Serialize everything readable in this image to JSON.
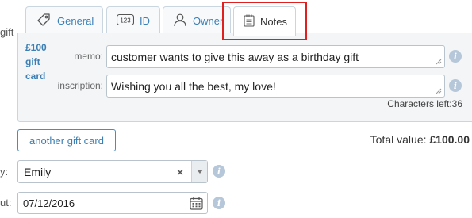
{
  "left_cut_labels": {
    "gift": "gift",
    "by": "y:",
    "out": "ut:"
  },
  "tabs": [
    {
      "label": "General",
      "icon": "tag-icon"
    },
    {
      "label": "ID",
      "icon": "id-123-icon",
      "icon_text": "123"
    },
    {
      "label": "Owner",
      "icon": "user-icon"
    },
    {
      "label": "Notes",
      "icon": "notepad-icon",
      "active": true
    }
  ],
  "card": {
    "line1": "£100",
    "line2": "gift",
    "line3": "card"
  },
  "memo": {
    "label": "memo:",
    "value": "customer wants to give this away as a birthday gift"
  },
  "inscription": {
    "label": "inscription:",
    "value": "Wishing you all the best, my love!"
  },
  "characters_left": "Characters left:36",
  "another_button": "another gift card",
  "total": {
    "label": "Total value:",
    "amount": "£100.00"
  },
  "seller_select": {
    "value": "Emily",
    "clear": "×"
  },
  "date_field": {
    "value": "07/12/2016"
  },
  "info_glyph": "i",
  "colors": {
    "accent": "#3b7fb5",
    "highlight": "#e02020",
    "panel_bg": "#f3f5f7",
    "info": "#b5c7d9"
  }
}
